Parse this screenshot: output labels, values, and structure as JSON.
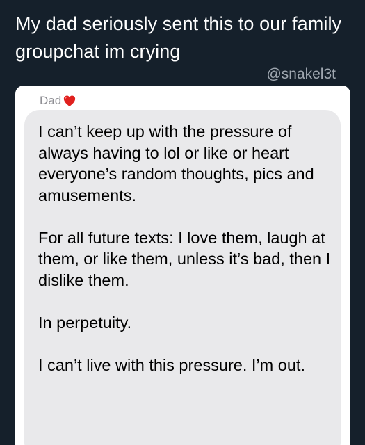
{
  "post": {
    "caption": "My dad seriously sent this to our family groupchat im crying",
    "handle": "@snakel3t"
  },
  "message": {
    "sender_name": "Dad",
    "sender_emoji_icon": "red-heart-icon",
    "heart_color": "#e0201e",
    "bubble_color": "#e9e9eb",
    "paragraphs": [
      "I can’t keep up with the pressure of always having to lol or like or heart everyone’s random thoughts, pics and amusements.",
      "For all future texts: I love them, laugh at them, or like them, unless it’s bad, then I dislike them.",
      "In perpetuity.",
      "I can’t live with this pressure.  I’m out."
    ]
  }
}
